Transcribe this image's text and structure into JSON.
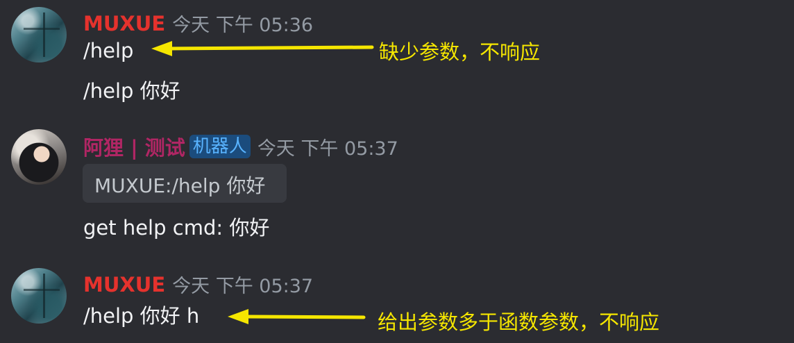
{
  "messages": [
    {
      "author": "MUXUE",
      "author_color": "#e5322d",
      "timestamp": "今天 下午 05:36",
      "lines": [
        "/help",
        "/help 你好"
      ]
    },
    {
      "author": "阿狸 | 测试",
      "author_color": "#b02664",
      "bot_tag": "机器人",
      "timestamp": "今天 下午 05:37",
      "reply": "MUXUE:/help 你好",
      "lines": [
        "get help cmd: 你好"
      ]
    },
    {
      "author": "MUXUE",
      "author_color": "#e5322d",
      "timestamp": "今天 下午 05:37",
      "lines": [
        "/help 你好 h"
      ]
    }
  ],
  "annotations": [
    {
      "text": "缺少参数，不响应",
      "color": "#f5e600"
    },
    {
      "text": "给出参数多于函数参数，不响应",
      "color": "#f5e600"
    }
  ],
  "icons": {
    "avatar_muxue": "avatar-image",
    "avatar_bot": "avatar-image",
    "arrow": "arrow-left-icon"
  }
}
